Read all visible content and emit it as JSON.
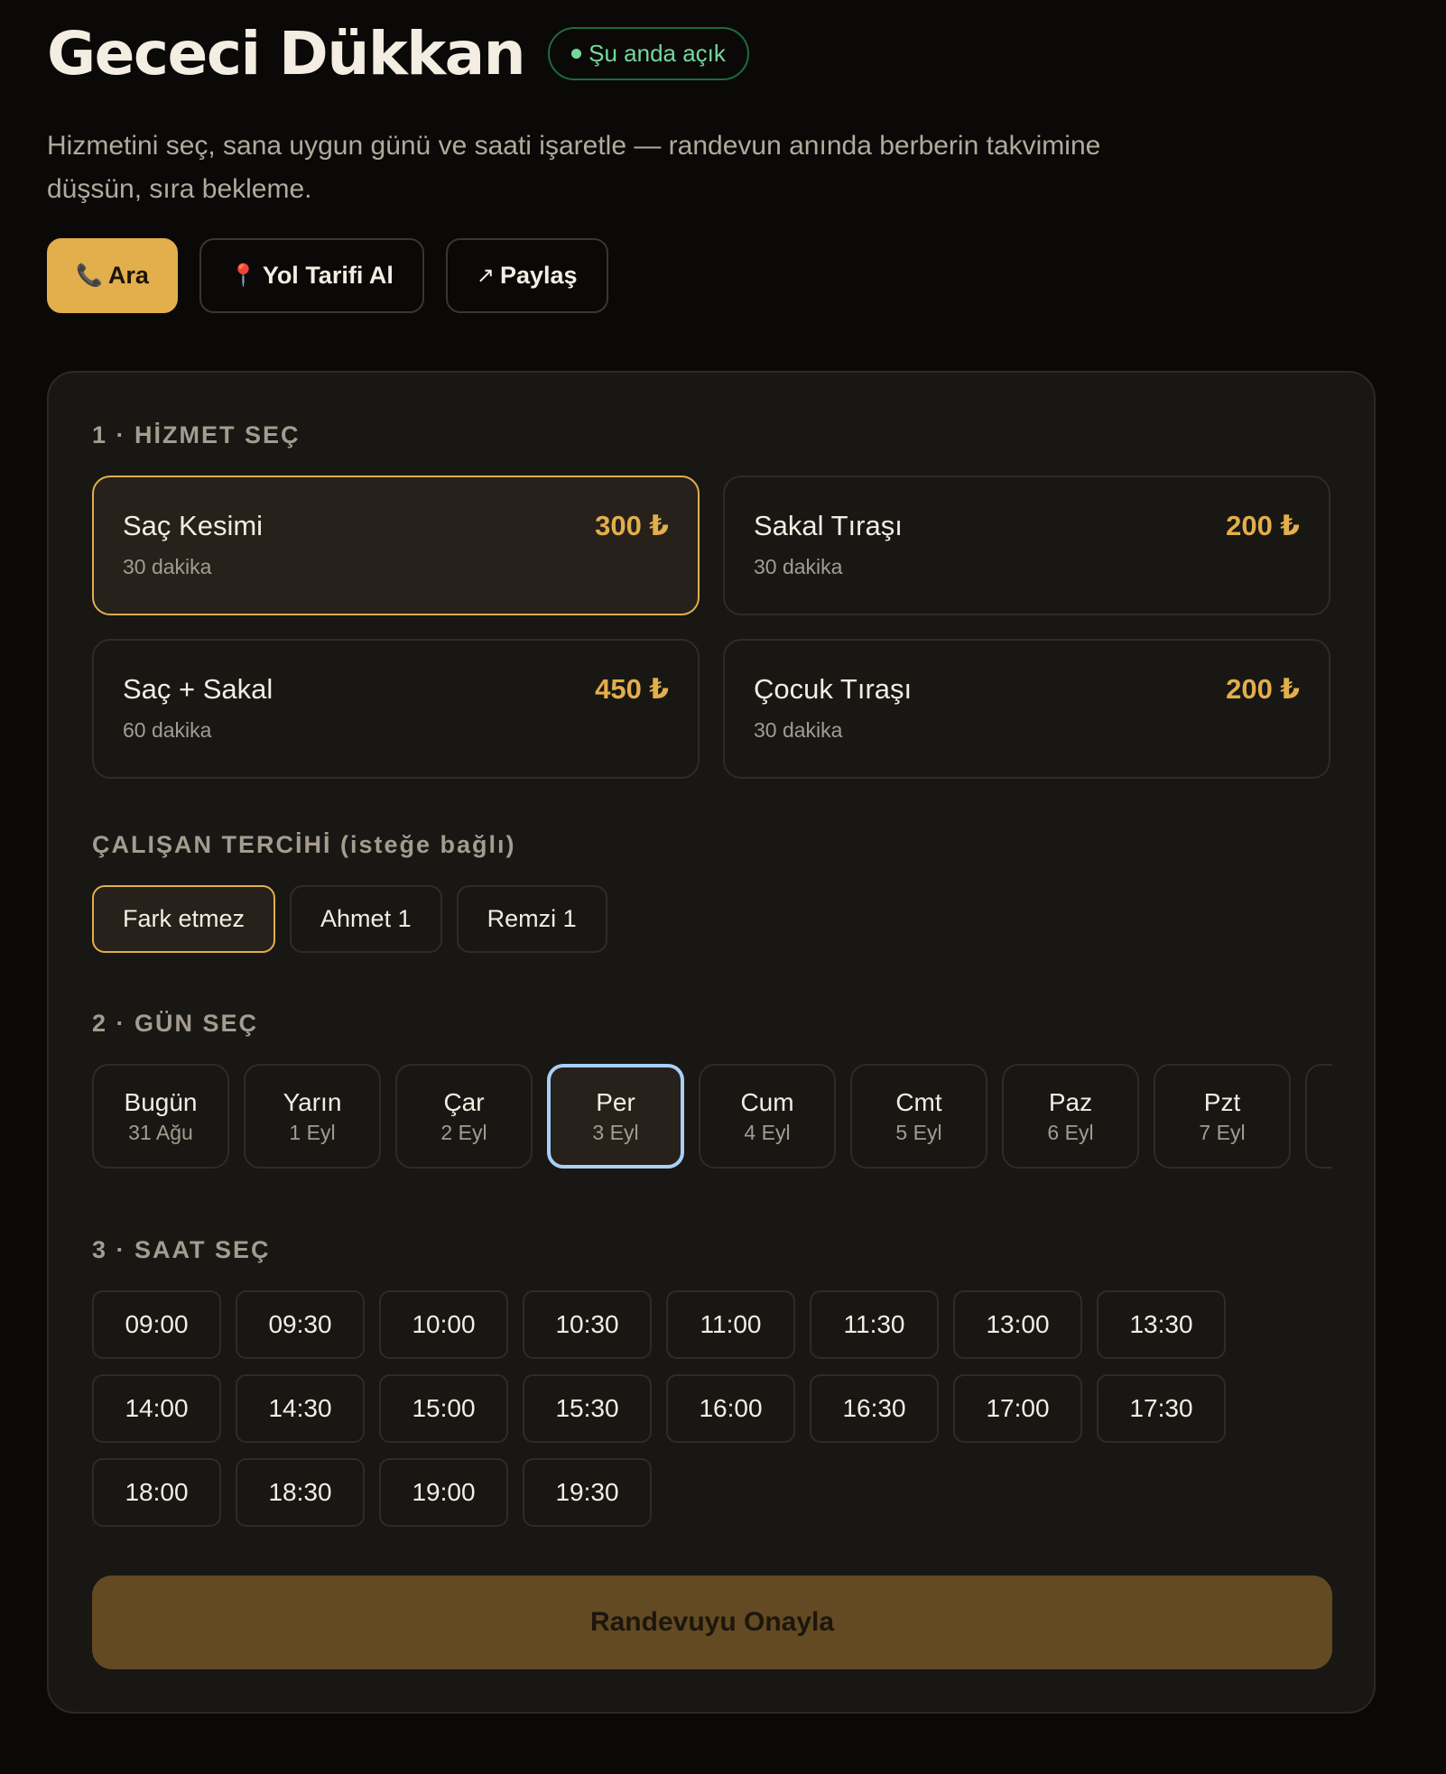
{
  "header": {
    "title": "Gececi Dükkan",
    "status": "Şu anda açık",
    "description": "Hizmetini seç, sana uygun günü ve saati işaretle — randevun anında berberin takvimine düşsün, sıra bekleme."
  },
  "actions": [
    {
      "icon": "📞",
      "icon_name": "phone-icon",
      "label": "Ara"
    },
    {
      "icon": "📍",
      "icon_name": "pin-icon",
      "label": "Yol Tarifi Al"
    },
    {
      "icon": "↗",
      "icon_name": "share-arrow-icon",
      "label": "Paylaş"
    }
  ],
  "services_section": {
    "label": "1 · HİZMET SEÇ",
    "items": [
      {
        "name": "Saç Kesimi",
        "duration": "30 dakika",
        "price": "300 ₺",
        "selected": true
      },
      {
        "name": "Sakal Tıraşı",
        "duration": "30 dakika",
        "price": "200 ₺",
        "selected": false
      },
      {
        "name": "Saç + Sakal",
        "duration": "60 dakika",
        "price": "450 ₺",
        "selected": false
      },
      {
        "name": "Çocuk Tıraşı",
        "duration": "30 dakika",
        "price": "200 ₺",
        "selected": false
      }
    ]
  },
  "staff_section": {
    "label": "ÇALIŞAN TERCİHİ (isteğe bağlı)",
    "options": [
      {
        "label": "Fark etmez",
        "selected": true
      },
      {
        "label": "Ahmet 1",
        "selected": false
      },
      {
        "label": "Remzi 1",
        "selected": false
      }
    ]
  },
  "days_section": {
    "label": "2 · GÜN SEÇ",
    "days": [
      {
        "name": "Bugün",
        "date": "31 Ağu",
        "selected": false
      },
      {
        "name": "Yarın",
        "date": "1 Eyl",
        "selected": false
      },
      {
        "name": "Çar",
        "date": "2 Eyl",
        "selected": false
      },
      {
        "name": "Per",
        "date": "3 Eyl",
        "selected": true
      },
      {
        "name": "Cum",
        "date": "4 Eyl",
        "selected": false
      },
      {
        "name": "Cmt",
        "date": "5 Eyl",
        "selected": false
      },
      {
        "name": "Paz",
        "date": "6 Eyl",
        "selected": false
      },
      {
        "name": "Pzt",
        "date": "7 Eyl",
        "selected": false
      },
      {
        "name": "",
        "date": "",
        "selected": false
      }
    ]
  },
  "times_section": {
    "label": "3 · SAAT SEÇ",
    "slots": [
      "09:00",
      "09:30",
      "10:00",
      "10:30",
      "11:00",
      "11:30",
      "13:00",
      "13:30",
      "14:00",
      "14:30",
      "15:00",
      "15:30",
      "16:00",
      "16:30",
      "17:00",
      "17:30",
      "18:00",
      "18:30",
      "19:00",
      "19:30"
    ]
  },
  "confirm_label": "Randevuyu Onayla",
  "colors": {
    "accent": "#e3ae4c",
    "background": "#0a0908",
    "panel": "#181714",
    "open_status": "#74d99a",
    "selected_day_border": "#a9cff7",
    "confirm_disabled": "#634a22"
  }
}
